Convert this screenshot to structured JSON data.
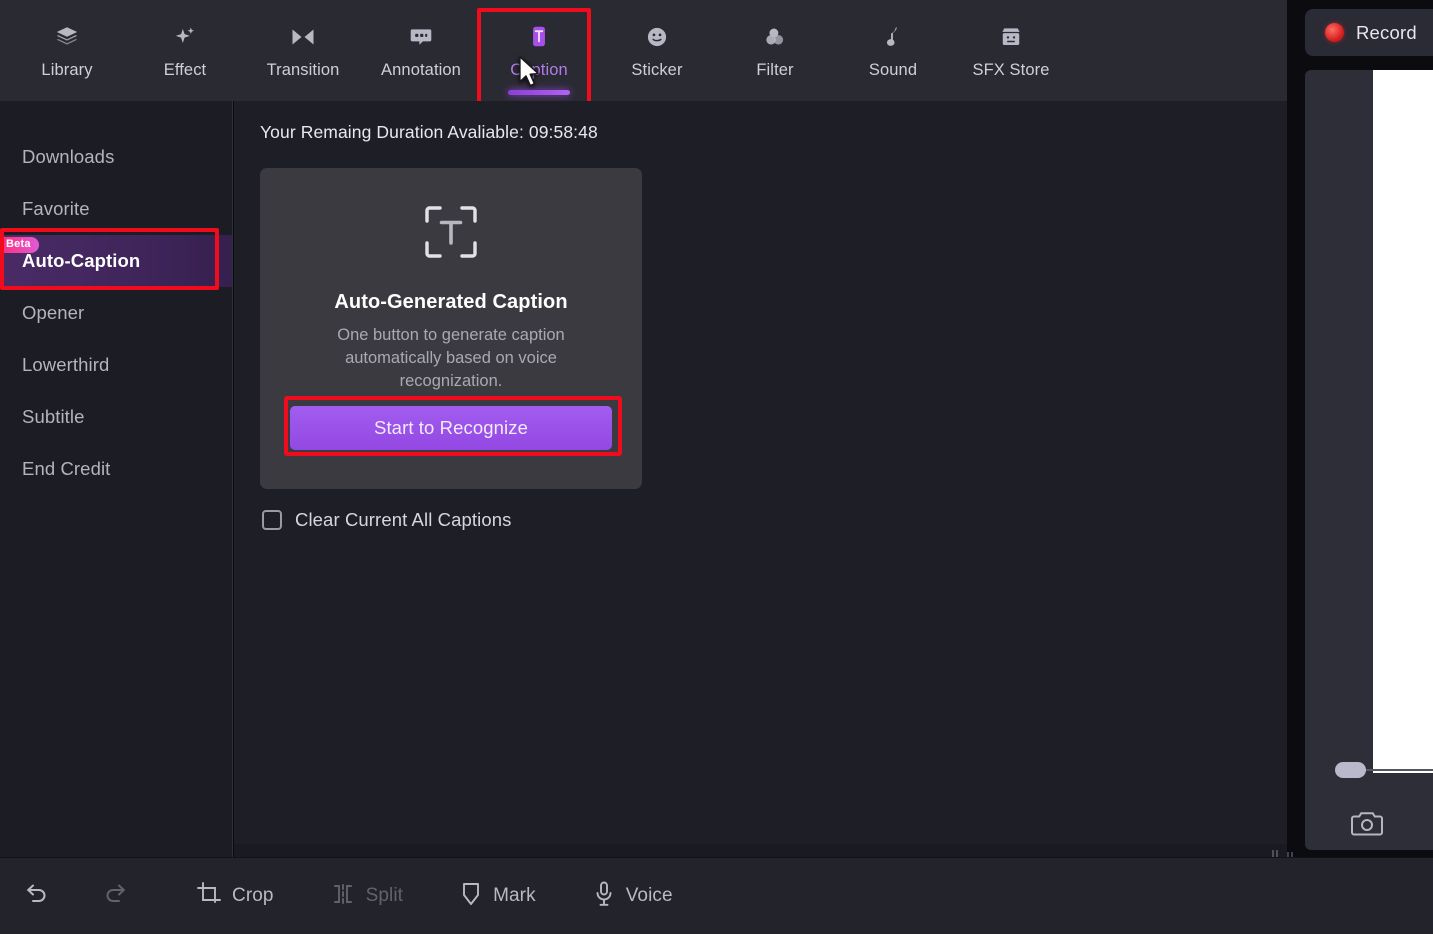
{
  "topbar": {
    "tabs": [
      {
        "label": "Library",
        "icon": "layers-icon",
        "active": false
      },
      {
        "label": "Effect",
        "icon": "sparkle-icon",
        "active": false
      },
      {
        "label": "Transition",
        "icon": "transition-icon",
        "active": false
      },
      {
        "label": "Annotation",
        "icon": "speech-bubble-icon",
        "active": false
      },
      {
        "label": "Caption",
        "icon": "caption-text-icon",
        "active": true
      },
      {
        "label": "Sticker",
        "icon": "smiley-icon",
        "active": false
      },
      {
        "label": "Filter",
        "icon": "filter-circles-icon",
        "active": false
      },
      {
        "label": "Sound",
        "icon": "music-note-icon",
        "active": false
      },
      {
        "label": "SFX Store",
        "icon": "store-icon",
        "active": false
      }
    ]
  },
  "sidebar": {
    "items": [
      {
        "label": "Downloads",
        "active": false,
        "badge": ""
      },
      {
        "label": "Favorite",
        "active": false,
        "badge": ""
      },
      {
        "label": "Auto-Caption",
        "active": true,
        "badge": "Beta"
      },
      {
        "label": "Opener",
        "active": false,
        "badge": ""
      },
      {
        "label": "Lowerthird",
        "active": false,
        "badge": ""
      },
      {
        "label": "Subtitle",
        "active": false,
        "badge": ""
      },
      {
        "label": "End Credit",
        "active": false,
        "badge": ""
      }
    ]
  },
  "main": {
    "duration_line": "Your Remaing Duration Avaliable: 09:58:48",
    "card": {
      "icon": "text-frame-icon",
      "title": "Auto-Generated Caption",
      "description": "One button to generate caption automatically based on voice recognization.",
      "button_label": "Start to Recognize"
    },
    "clear_checkbox": {
      "label": "Clear Current All Captions",
      "checked": false
    }
  },
  "right_panel": {
    "record_label": "Record",
    "record_dot_color": "#d61f1f",
    "snapshot_icon": "camera-icon",
    "slider_value": 0
  },
  "bottombar": {
    "tools": [
      {
        "label": "",
        "icon": "undo-icon",
        "enabled": true
      },
      {
        "label": "",
        "icon": "redo-icon",
        "enabled": false
      },
      {
        "label": "Crop",
        "icon": "crop-icon",
        "enabled": true
      },
      {
        "label": "Split",
        "icon": "split-icon",
        "enabled": false
      },
      {
        "label": "Mark",
        "icon": "marker-icon",
        "enabled": true
      },
      {
        "label": "Voice",
        "icon": "microphone-icon",
        "enabled": true
      }
    ]
  },
  "annotations": {
    "highlight_color": "#f00b1d",
    "boxes": [
      "caption-tab",
      "auto-caption-sidebar-item",
      "start-to-recognize-button"
    ]
  },
  "theme": {
    "accent_purple": "#9b4fe0",
    "badge_pink": "#ff2d7a",
    "topbar_bg": "#2a2a33",
    "sidebar_bg": "#1c1c24",
    "main_bg": "#1e1e26",
    "card_bg": "#3a3a40"
  }
}
